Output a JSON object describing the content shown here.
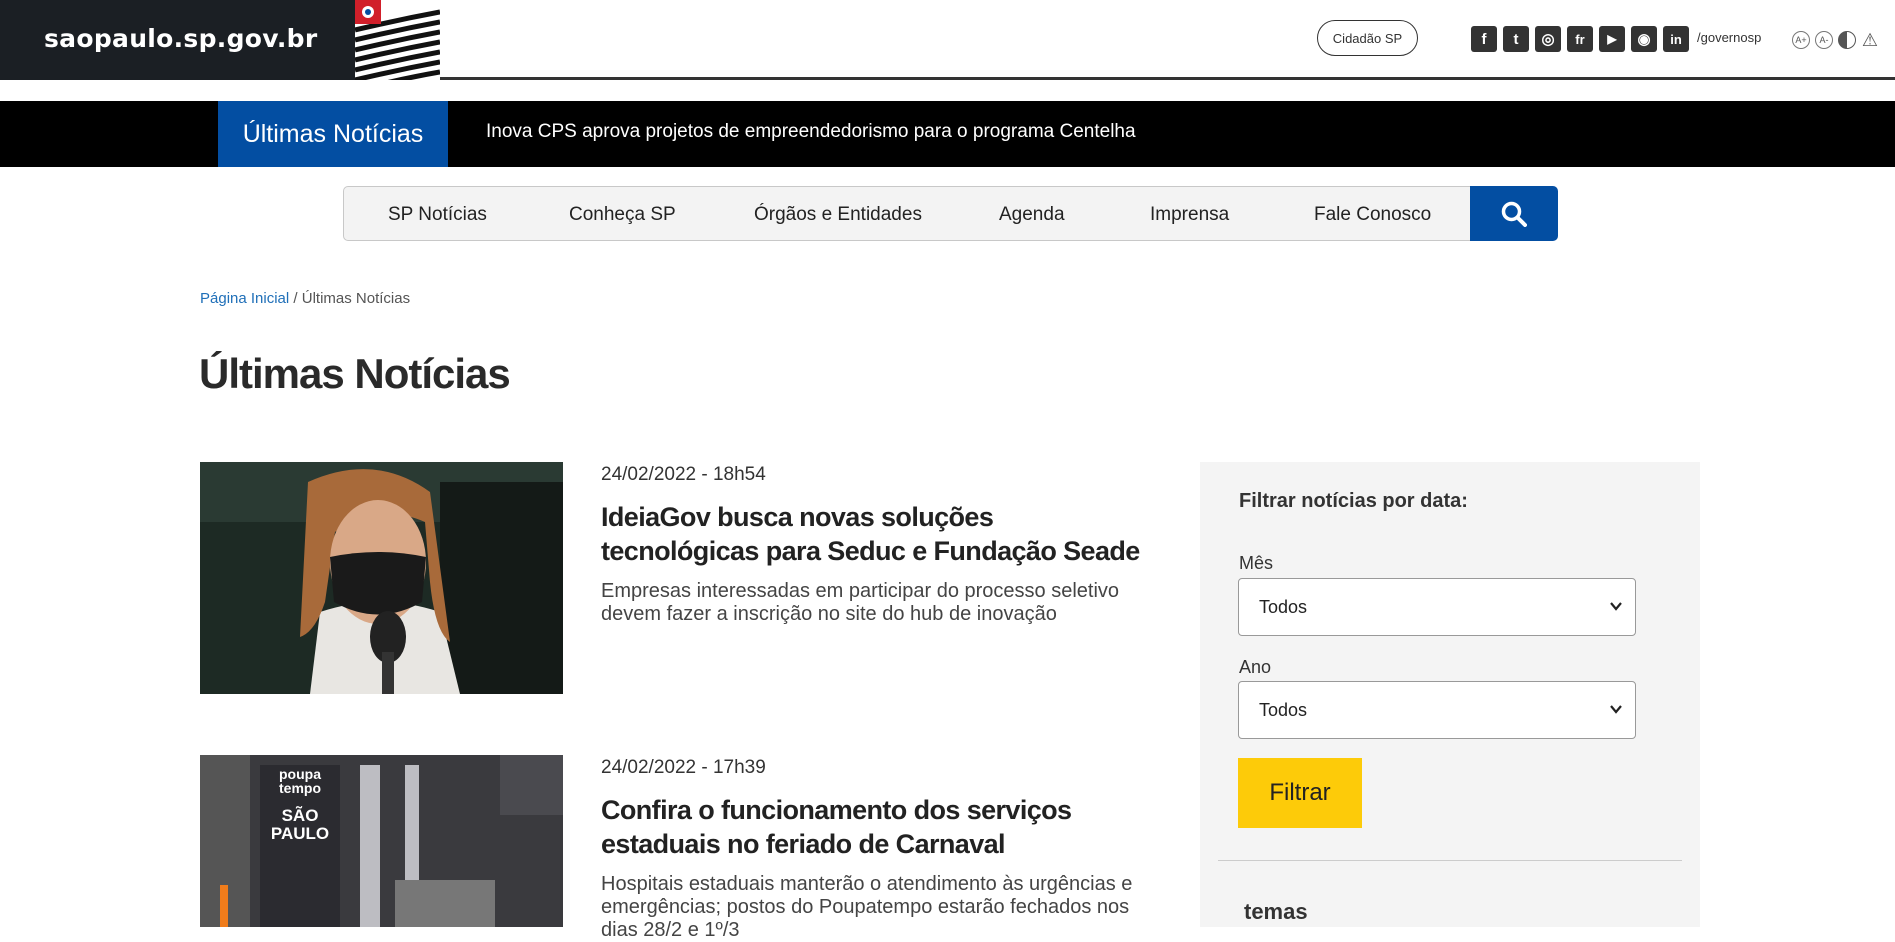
{
  "header": {
    "site_name": "saopaulo.sp.gov.br",
    "cidadao_button": "Cidadão SP",
    "social_icons": [
      {
        "name": "facebook-icon",
        "glyph": "f"
      },
      {
        "name": "twitter-icon",
        "glyph": "t"
      },
      {
        "name": "instagram-icon",
        "glyph": "◎"
      },
      {
        "name": "flickr-icon",
        "glyph": "fr"
      },
      {
        "name": "youtube-icon",
        "glyph": "▶"
      },
      {
        "name": "spotify-icon",
        "glyph": "◉"
      },
      {
        "name": "linkedin-icon",
        "glyph": "in"
      }
    ],
    "social_handle": "/governosp",
    "accessibility_icons": [
      "font-increase-icon",
      "font-decrease-icon",
      "contrast-icon",
      "warning-icon"
    ]
  },
  "ticker": {
    "label": "Últimas Notícias",
    "headline": "Inova CPS aprova projetos de empreendedorismo para o programa Centelha"
  },
  "nav": {
    "items": [
      "SP Notícias",
      "Conheça SP",
      "Órgãos e Entidades",
      "Agenda",
      "Imprensa",
      "Fale Conosco"
    ],
    "search_icon": "search-icon"
  },
  "breadcrumb": {
    "home": "Página Inicial",
    "separator": " / ",
    "current": "Últimas Notícias"
  },
  "page_title": "Últimas Notícias",
  "articles": [
    {
      "date": "24/02/2022 - 18h54",
      "title": "IdeiaGov busca novas soluções tecnológicas para Seduc e Fundação Seade",
      "subtitle": "Empresas interessadas em participar do processo seletivo devem fazer a inscrição no site do hub de inovação"
    },
    {
      "date": "24/02/2022 - 17h39",
      "title": "Confira o funcionamento dos serviços estaduais no feriado de Carnaval",
      "subtitle": "Hospitais estaduais manterão o atendimento às urgências e emergências; postos do Poupatempo estarão fechados nos dias 28/2 e 1º/3"
    }
  ],
  "filter": {
    "title": "Filtrar notícias por data:",
    "month_label": "Mês",
    "month_value": "Todos",
    "year_label": "Ano",
    "year_value": "Todos",
    "button": "Filtrar",
    "temas_heading": "temas"
  },
  "colors": {
    "brand_blue": "#034ea2",
    "filter_yellow": "#fdcb09",
    "ticker_black": "#000000",
    "logo_dark": "#1b1f24"
  }
}
